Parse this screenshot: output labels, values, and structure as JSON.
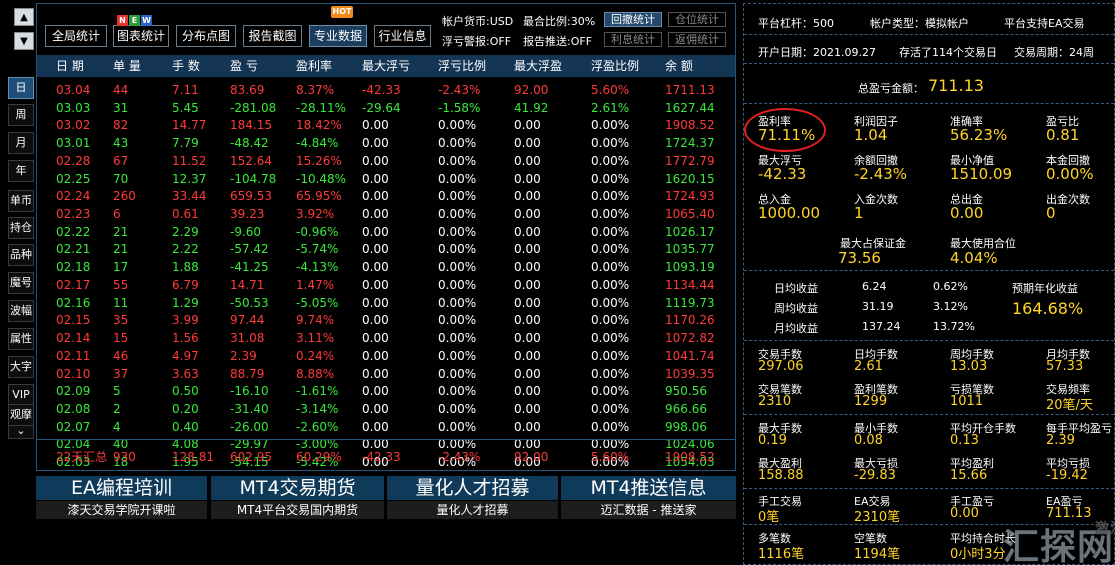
{
  "nav": {
    "up": "▲",
    "down": "▼",
    "periods": [
      "日",
      "周",
      "月",
      "年"
    ],
    "side_items": [
      "单币",
      "持仓",
      "品种",
      "魔号",
      "波幅",
      "属性",
      "大字",
      "VIP",
      "观摩"
    ],
    "more": "⌄"
  },
  "toolbar": {
    "buttons": [
      "全局统计",
      "图表统计",
      "分布点图",
      "报告截图",
      "专业数据",
      "行业信息"
    ],
    "new_badge": [
      "N",
      "E",
      "W"
    ],
    "hot_badge": "HOT",
    "currency": "帐户货币:USD",
    "max_ratio": "最合比例:30%",
    "float_alert": "浮亏警报:OFF",
    "report_push": "报告推送:OFF",
    "small_buttons": [
      "回撤统计",
      "仓位统计",
      "利息统计",
      "返佣统计"
    ]
  },
  "table": {
    "headers": [
      "日 期",
      "单 量",
      "手 数",
      "盈 亏",
      "盈利率",
      "最大浮亏",
      "浮亏比例",
      "最大浮盈",
      "浮盈比例",
      "余 额"
    ],
    "rows": [
      {
        "date": "03.04",
        "orders": "44",
        "lots": "7.11",
        "pnl": "83.69",
        "rate": "8.37%",
        "maxdd": "-42.33",
        "ddpct": "-2.43%",
        "maxup": "92.00",
        "uppct": "5.60%",
        "bal": "1711.13",
        "color": "red"
      },
      {
        "date": "03.03",
        "orders": "31",
        "lots": "5.45",
        "pnl": "-281.08",
        "rate": "-28.11%",
        "maxdd": "-29.64",
        "ddpct": "-1.58%",
        "maxup": "41.92",
        "uppct": "2.61%",
        "bal": "1627.44",
        "color": "green"
      },
      {
        "date": "03.02",
        "orders": "82",
        "lots": "14.77",
        "pnl": "184.15",
        "rate": "18.42%",
        "maxdd": "0.00",
        "ddpct": "0.00%",
        "maxup": "0.00",
        "uppct": "0.00%",
        "bal": "1908.52",
        "color": "red"
      },
      {
        "date": "03.01",
        "orders": "43",
        "lots": "7.79",
        "pnl": "-48.42",
        "rate": "-4.84%",
        "maxdd": "0.00",
        "ddpct": "0.00%",
        "maxup": "0.00",
        "uppct": "0.00%",
        "bal": "1724.37",
        "color": "green"
      },
      {
        "date": "02.28",
        "orders": "67",
        "lots": "11.52",
        "pnl": "152.64",
        "rate": "15.26%",
        "maxdd": "0.00",
        "ddpct": "0.00%",
        "maxup": "0.00",
        "uppct": "0.00%",
        "bal": "1772.79",
        "color": "red"
      },
      {
        "date": "02.25",
        "orders": "70",
        "lots": "12.37",
        "pnl": "-104.78",
        "rate": "-10.48%",
        "maxdd": "0.00",
        "ddpct": "0.00%",
        "maxup": "0.00",
        "uppct": "0.00%",
        "bal": "1620.15",
        "color": "green"
      },
      {
        "date": "02.24",
        "orders": "260",
        "lots": "33.44",
        "pnl": "659.53",
        "rate": "65.95%",
        "maxdd": "0.00",
        "ddpct": "0.00%",
        "maxup": "0.00",
        "uppct": "0.00%",
        "bal": "1724.93",
        "color": "red"
      },
      {
        "date": "02.23",
        "orders": "6",
        "lots": "0.61",
        "pnl": "39.23",
        "rate": "3.92%",
        "maxdd": "0.00",
        "ddpct": "0.00%",
        "maxup": "0.00",
        "uppct": "0.00%",
        "bal": "1065.40",
        "color": "red"
      },
      {
        "date": "02.22",
        "orders": "21",
        "lots": "2.29",
        "pnl": "-9.60",
        "rate": "-0.96%",
        "maxdd": "0.00",
        "ddpct": "0.00%",
        "maxup": "0.00",
        "uppct": "0.00%",
        "bal": "1026.17",
        "color": "green"
      },
      {
        "date": "02.21",
        "orders": "21",
        "lots": "2.22",
        "pnl": "-57.42",
        "rate": "-5.74%",
        "maxdd": "0.00",
        "ddpct": "0.00%",
        "maxup": "0.00",
        "uppct": "0.00%",
        "bal": "1035.77",
        "color": "green"
      },
      {
        "date": "02.18",
        "orders": "17",
        "lots": "1.88",
        "pnl": "-41.25",
        "rate": "-4.13%",
        "maxdd": "0.00",
        "ddpct": "0.00%",
        "maxup": "0.00",
        "uppct": "0.00%",
        "bal": "1093.19",
        "color": "green"
      },
      {
        "date": "02.17",
        "orders": "55",
        "lots": "6.79",
        "pnl": "14.71",
        "rate": "1.47%",
        "maxdd": "0.00",
        "ddpct": "0.00%",
        "maxup": "0.00",
        "uppct": "0.00%",
        "bal": "1134.44",
        "color": "red"
      },
      {
        "date": "02.16",
        "orders": "11",
        "lots": "1.29",
        "pnl": "-50.53",
        "rate": "-5.05%",
        "maxdd": "0.00",
        "ddpct": "0.00%",
        "maxup": "0.00",
        "uppct": "0.00%",
        "bal": "1119.73",
        "color": "green"
      },
      {
        "date": "02.15",
        "orders": "35",
        "lots": "3.99",
        "pnl": "97.44",
        "rate": "9.74%",
        "maxdd": "0.00",
        "ddpct": "0.00%",
        "maxup": "0.00",
        "uppct": "0.00%",
        "bal": "1170.26",
        "color": "red"
      },
      {
        "date": "02.14",
        "orders": "15",
        "lots": "1.56",
        "pnl": "31.08",
        "rate": "3.11%",
        "maxdd": "0.00",
        "ddpct": "0.00%",
        "maxup": "0.00",
        "uppct": "0.00%",
        "bal": "1072.82",
        "color": "red"
      },
      {
        "date": "02.11",
        "orders": "46",
        "lots": "4.97",
        "pnl": "2.39",
        "rate": "0.24%",
        "maxdd": "0.00",
        "ddpct": "0.00%",
        "maxup": "0.00",
        "uppct": "0.00%",
        "bal": "1041.74",
        "color": "red"
      },
      {
        "date": "02.10",
        "orders": "37",
        "lots": "3.63",
        "pnl": "88.79",
        "rate": "8.88%",
        "maxdd": "0.00",
        "ddpct": "0.00%",
        "maxup": "0.00",
        "uppct": "0.00%",
        "bal": "1039.35",
        "color": "red"
      },
      {
        "date": "02.09",
        "orders": "5",
        "lots": "0.50",
        "pnl": "-16.10",
        "rate": "-1.61%",
        "maxdd": "0.00",
        "ddpct": "0.00%",
        "maxup": "0.00",
        "uppct": "0.00%",
        "bal": "950.56",
        "color": "green"
      },
      {
        "date": "02.08",
        "orders": "2",
        "lots": "0.20",
        "pnl": "-31.40",
        "rate": "-3.14%",
        "maxdd": "0.00",
        "ddpct": "0.00%",
        "maxup": "0.00",
        "uppct": "0.00%",
        "bal": "966.66",
        "color": "green"
      },
      {
        "date": "02.07",
        "orders": "4",
        "lots": "0.40",
        "pnl": "-26.00",
        "rate": "-2.60%",
        "maxdd": "0.00",
        "ddpct": "0.00%",
        "maxup": "0.00",
        "uppct": "0.00%",
        "bal": "998.06",
        "color": "green"
      },
      {
        "date": "02.04",
        "orders": "40",
        "lots": "4.08",
        "pnl": "-29.97",
        "rate": "-3.00%",
        "maxdd": "0.00",
        "ddpct": "0.00%",
        "maxup": "0.00",
        "uppct": "0.00%",
        "bal": "1024.06",
        "color": "green"
      },
      {
        "date": "02.03",
        "orders": "18",
        "lots": "1.95",
        "pnl": "-54.15",
        "rate": "-5.42%",
        "maxdd": "0.00",
        "ddpct": "0.00%",
        "maxup": "0.00",
        "uppct": "0.00%",
        "bal": "1054.03",
        "color": "green"
      }
    ],
    "summary": [
      "22天汇总",
      "930",
      "128.81",
      "602.95",
      "60.29%",
      "-42.33",
      "-2.43%",
      "92.00",
      "5.60%",
      "1908.52"
    ]
  },
  "banners": [
    {
      "title": "EA编程培训",
      "sub": "漆天交易学院开课啦"
    },
    {
      "title": "MT4交易期货",
      "sub": "MT4平台交易国内期货"
    },
    {
      "title": "量化人才招募",
      "sub": "量化人才招募"
    },
    {
      "title": "MT4推送信息",
      "sub": "迈汇数据 - 推送家"
    }
  ],
  "stats": {
    "top": [
      "平台杠杆：500",
      "帐户类型：模拟帐户",
      "平台支持EA交易",
      "开户日期：2021.09.27",
      "存活了114个交易日",
      "交易周期：24周"
    ],
    "total_label": "总盈亏金额：",
    "total_value": "711.13",
    "grid1": [
      {
        "label": "盈利率",
        "value": "71.11%"
      },
      {
        "label": "利润因子",
        "value": "1.04"
      },
      {
        "label": "准确率",
        "value": "56.23%"
      },
      {
        "label": "盈亏比",
        "value": "0.81"
      },
      {
        "label": "最大浮亏",
        "value": "-42.33"
      },
      {
        "label": "余额回撤",
        "value": "-2.43%"
      },
      {
        "label": "最小净值",
        "value": "1510.09"
      },
      {
        "label": "本金回撤",
        "value": "0.00%"
      },
      {
        "label": "总入金",
        "value": "1000.00"
      },
      {
        "label": "入金次数",
        "value": "1"
      },
      {
        "label": "总出金",
        "value": "0.00"
      },
      {
        "label": "出金次数",
        "value": "0"
      }
    ],
    "margin": [
      {
        "label": "最大占保证金",
        "value": "73.56"
      },
      {
        "label": "最大使用合位",
        "value": "4.04%"
      }
    ],
    "avg": [
      {
        "label": "日均收益",
        "amount": "6.24",
        "pct": "0.62%"
      },
      {
        "label": "周均收益",
        "amount": "31.19",
        "pct": "3.12%"
      },
      {
        "label": "月均收益",
        "amount": "137.24",
        "pct": "13.72%"
      }
    ],
    "annual_label": "预期年化收益",
    "annual_value": "164.68%",
    "grid2": [
      {
        "label": "交易手数",
        "value": "297.06"
      },
      {
        "label": "日均手数",
        "value": "2.61"
      },
      {
        "label": "周均手数",
        "value": "13.03"
      },
      {
        "label": "月均手数",
        "value": "57.33"
      },
      {
        "label": "交易笔数",
        "value": "2310"
      },
      {
        "label": "盈利笔数",
        "value": "1299"
      },
      {
        "label": "亏损笔数",
        "value": "1011"
      },
      {
        "label": "交易频率",
        "value": "20笔/天"
      }
    ],
    "grid3": [
      {
        "label": "最大手数",
        "value": "0.19"
      },
      {
        "label": "最小手数",
        "value": "0.08"
      },
      {
        "label": "平均开仓手数",
        "value": "0.13"
      },
      {
        "label": "每手平均盈亏",
        "value": "2.39"
      },
      {
        "label": "最大盈利",
        "value": "158.88"
      },
      {
        "label": "最大亏损",
        "value": "-29.83"
      },
      {
        "label": "平均盈利",
        "value": "15.66"
      },
      {
        "label": "平均亏损",
        "value": "-19.42"
      }
    ],
    "grid4": [
      {
        "label": "手工交易",
        "value": "0笔"
      },
      {
        "label": "EA交易",
        "value": "2310笔"
      },
      {
        "label": "手工盈亏",
        "value": "0.00"
      },
      {
        "label": "EA盈亏",
        "value": "711.13"
      }
    ],
    "grid5": [
      {
        "label": "多笔数",
        "value": "1116笔"
      },
      {
        "label": "空笔数",
        "value": "1194笔"
      },
      {
        "label": "平均持合时长",
        "value": "0小时3分"
      }
    ]
  },
  "watermark": {
    "text": "汇探网",
    "cut": "激活"
  },
  "colors": {
    "profit": "#ff3a3a",
    "loss": "#39e83c",
    "value": "#ffd42b",
    "header": "#153555"
  }
}
